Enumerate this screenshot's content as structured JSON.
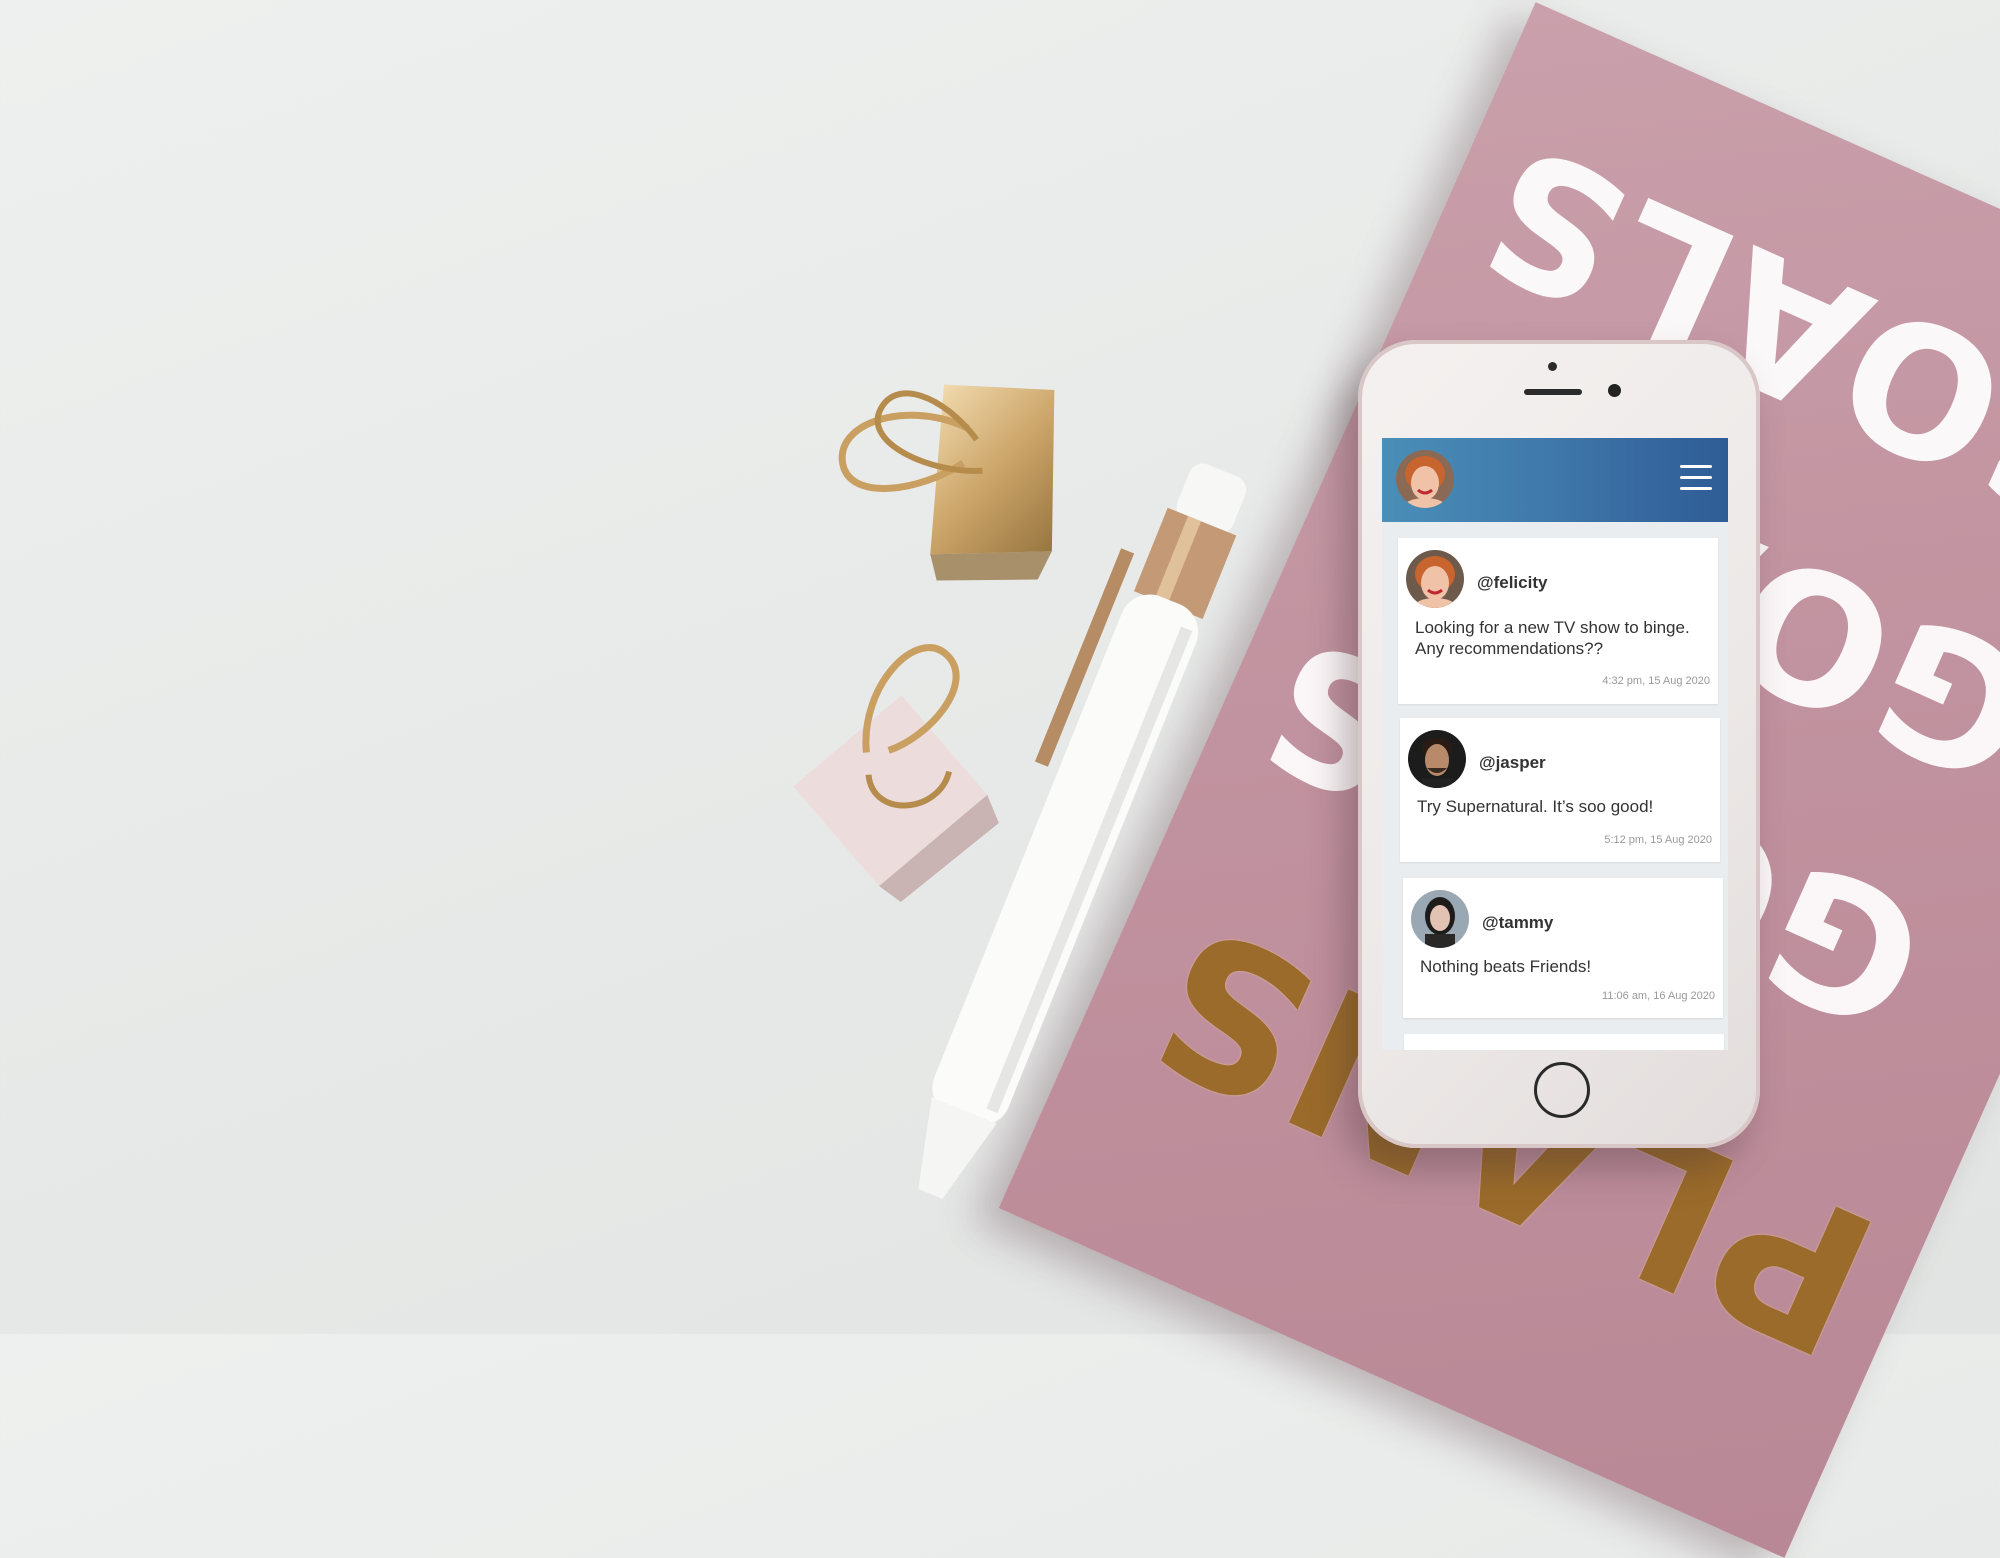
{
  "notebook": {
    "cover_words": [
      "GOALS",
      "GOALS",
      "GOALS",
      "PLANS"
    ]
  },
  "app": {
    "header": {
      "profile_avatar": "profile-avatar",
      "menu_icon": "hamburger-menu-icon",
      "gradient_start": "#4a8fb8",
      "gradient_end": "#2f5c95"
    },
    "posts": [
      {
        "username": "@felicity",
        "text": "Looking for a new TV show to binge. Any recommendations??",
        "timestamp": "4:32 pm, 15 Aug 2020"
      },
      {
        "username": "@jasper",
        "text": "Try Supernatural. It’s soo good!",
        "timestamp": "5:12 pm, 15 Aug 2020"
      },
      {
        "username": "@tammy",
        "text": "Nothing beats Friends!",
        "timestamp": "11:06 am, 16 Aug 2020"
      }
    ]
  }
}
